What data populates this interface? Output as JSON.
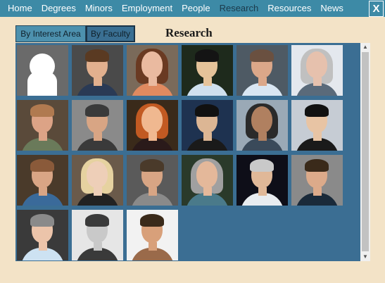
{
  "nav": {
    "items": [
      "Home",
      "Degrees",
      "Minors",
      "Employment",
      "People",
      "Research",
      "Resources",
      "News"
    ],
    "active": "Research",
    "close_label": "X"
  },
  "tabs": {
    "interest": "By Interest Area",
    "faculty": "By Faculty"
  },
  "page_title": "Research",
  "colors": {
    "nav_bg": "#3d8aa6",
    "page_bg": "#f3e3c7",
    "panel_bg": "#3b6e93"
  },
  "scrollbar": {
    "up_icon": "▲",
    "down_icon": "▼"
  },
  "faculty_photos": [
    {
      "kind": "placeholder"
    },
    {
      "kind": "person",
      "bg": "#4a4a4a",
      "skin": "#e2b08e",
      "hair": "#5a3a22",
      "shirt": "#2a3a55"
    },
    {
      "kind": "person",
      "bg": "#7a6a5a",
      "skin": "#eabaa0",
      "hair": "#6a3a22",
      "shirt": "#e08a60",
      "long": true
    },
    {
      "kind": "person",
      "bg": "#1e2a1c",
      "skin": "#e5c39a",
      "hair": "#141414",
      "shirt": "#cfe0ee"
    },
    {
      "kind": "person",
      "bg": "#4e5a64",
      "skin": "#dba789",
      "hair": "#6a5040",
      "shirt": "#d9e6f2"
    },
    {
      "kind": "person",
      "bg": "#e4e8ee",
      "skin": "#e6c1ad",
      "hair": "#c0c0c0",
      "shirt": "#5a6a7a",
      "long": true
    },
    {
      "kind": "person",
      "bg": "#5a4a3a",
      "skin": "#dca386",
      "hair": "#b07a50",
      "shirt": "#6a7a5a"
    },
    {
      "kind": "person",
      "bg": "#8a8a8a",
      "skin": "#d8a584",
      "hair": "#3a3a3a",
      "shirt": "#3a3a3a"
    },
    {
      "kind": "person",
      "bg": "#3a2a1a",
      "skin": "#f0b890",
      "hair": "#c25a22",
      "shirt": "#2a1a1a",
      "long": true
    },
    {
      "kind": "person",
      "bg": "#1e3250",
      "skin": "#dcb694",
      "hair": "#111111",
      "shirt": "#1a1a1a"
    },
    {
      "kind": "person",
      "bg": "#9aa9b6",
      "skin": "#b08060",
      "hair": "#2a2a2a",
      "shirt": "#3a4a5a",
      "long": true
    },
    {
      "kind": "person",
      "bg": "#c6ccd4",
      "skin": "#e8c4a4",
      "hair": "#111111",
      "shirt": "#1a1a1a"
    },
    {
      "kind": "person",
      "bg": "#4a3a2a",
      "skin": "#d9a585",
      "hair": "#8a5a3a",
      "shirt": "#3a6a9a"
    },
    {
      "kind": "person",
      "bg": "#6a5a4a",
      "skin": "#eecfb8",
      "hair": "#e6d2a0",
      "shirt": "#222222",
      "long": true
    },
    {
      "kind": "person",
      "bg": "#5a5a5a",
      "skin": "#d8a584",
      "hair": "#4a3a2a",
      "shirt": "#8a8a8a"
    },
    {
      "kind": "person",
      "bg": "#2a3a2a",
      "skin": "#e4b89a",
      "hair": "#a0a0a0",
      "shirt": "#4a7a8a",
      "long": true
    },
    {
      "kind": "person",
      "bg": "#0e0e18",
      "skin": "#e0b898",
      "hair": "#c9c9c9",
      "shirt": "#e8ecf0"
    },
    {
      "kind": "person",
      "bg": "#8a8a8a",
      "skin": "#dcaa8a",
      "hair": "#3a2a1a",
      "shirt": "#1a2a3a"
    },
    {
      "kind": "person",
      "bg": "#3a3a3a",
      "skin": "#ecc4aa",
      "hair": "#8a8a8a",
      "shirt": "#cde2f2"
    },
    {
      "kind": "person",
      "bg": "#e6e6e6",
      "skin": "#c9c9c9",
      "hair": "#3a3a3a",
      "shirt": "#3a3a3a"
    },
    {
      "kind": "person",
      "bg": "#f2f2f2",
      "skin": "#d8a07a",
      "hair": "#3a2a1a",
      "shirt": "#9a6a4a"
    }
  ]
}
